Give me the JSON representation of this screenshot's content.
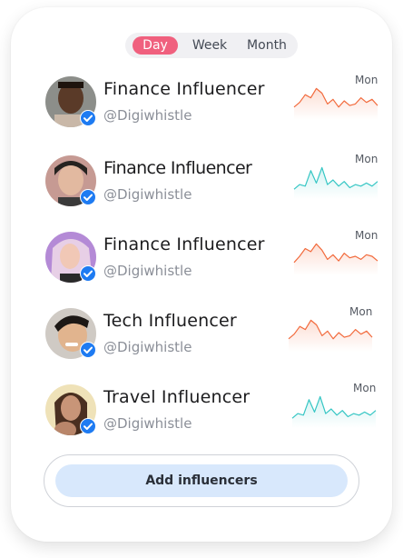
{
  "period_tabs": [
    {
      "label": "Day",
      "active": true
    },
    {
      "label": "Week",
      "active": false
    },
    {
      "label": "Month",
      "active": false
    }
  ],
  "colors": {
    "active_tab": "#f0607e",
    "trend_orange": "#f26a3c",
    "trend_teal": "#35c6c4",
    "verified": "#1e7bf2",
    "button_bg": "#d8e8fc"
  },
  "influencers": [
    {
      "name": "Finance Influencer",
      "handle": "@Digiwhistle",
      "sparkline_label": "Mon",
      "trend_color": "orange",
      "trend": [
        0.3,
        0.45,
        0.7,
        0.6,
        0.9,
        0.75,
        0.4,
        0.55,
        0.3,
        0.5,
        0.35,
        0.4,
        0.6,
        0.45,
        0.55,
        0.35
      ]
    },
    {
      "name": "Finance Influencer",
      "handle": "@Digiwhistle",
      "sparkline_label": "Mon",
      "trend_color": "teal",
      "trend": [
        0.2,
        0.35,
        0.3,
        0.8,
        0.4,
        0.9,
        0.35,
        0.5,
        0.3,
        0.45,
        0.25,
        0.35,
        0.3,
        0.4,
        0.3,
        0.45
      ]
    },
    {
      "name": "Finance Influencer",
      "handle": "@Digiwhistle",
      "sparkline_label": "Mon",
      "trend_color": "orange",
      "trend": [
        0.3,
        0.5,
        0.75,
        0.65,
        0.9,
        0.7,
        0.4,
        0.55,
        0.35,
        0.6,
        0.45,
        0.5,
        0.4,
        0.55,
        0.5,
        0.35
      ]
    },
    {
      "name": "Tech Influencer",
      "handle": "@Digiwhistle",
      "sparkline_label": "Mon",
      "trend_color": "orange",
      "trend": [
        0.3,
        0.45,
        0.7,
        0.6,
        0.9,
        0.75,
        0.4,
        0.55,
        0.3,
        0.5,
        0.35,
        0.4,
        0.6,
        0.45,
        0.55,
        0.35
      ]
    },
    {
      "name": "Travel Influencer",
      "handle": "@Digiwhistle",
      "sparkline_label": "Mon",
      "trend_color": "teal",
      "trend": [
        0.2,
        0.35,
        0.3,
        0.8,
        0.4,
        0.9,
        0.35,
        0.5,
        0.3,
        0.45,
        0.25,
        0.35,
        0.3,
        0.4,
        0.3,
        0.45
      ]
    }
  ],
  "add_button_label": "Add influencers"
}
